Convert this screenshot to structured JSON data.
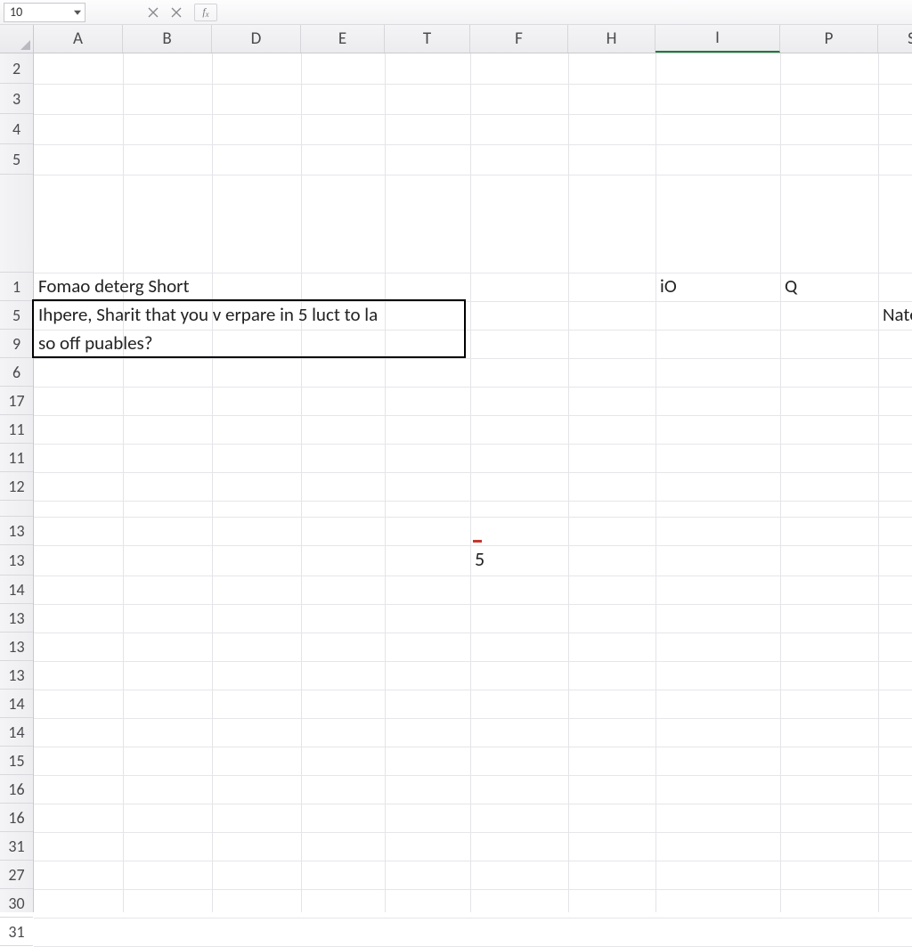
{
  "toolbar": {
    "namebox_value": "10",
    "cancel_icon": "x",
    "enter_icon": "x",
    "fx_label": "fx"
  },
  "columns": [
    {
      "id": "A",
      "label": "A",
      "width": 100
    },
    {
      "id": "B",
      "label": "B",
      "width": 100
    },
    {
      "id": "D",
      "label": "D",
      "width": 100
    },
    {
      "id": "E",
      "label": "E",
      "width": 94
    },
    {
      "id": "T",
      "label": "T",
      "width": 96
    },
    {
      "id": "F",
      "label": "F",
      "width": 110
    },
    {
      "id": "H",
      "label": "H",
      "width": 98
    },
    {
      "id": "I",
      "label": "I",
      "width": 140,
      "active": true
    },
    {
      "id": "P",
      "label": "P",
      "width": 110
    },
    {
      "id": "S",
      "label": "S",
      "width": 76
    }
  ],
  "rows": [
    {
      "id": "2",
      "height": 34
    },
    {
      "id": "3",
      "height": 34
    },
    {
      "id": "4",
      "height": 34
    },
    {
      "id": "5",
      "height": 34
    },
    {
      "id": "gap1",
      "height": 110,
      "blank": true
    },
    {
      "id": "1",
      "height": 32
    },
    {
      "id": "5b",
      "label": "5",
      "height": 32
    },
    {
      "id": "9",
      "height": 32
    },
    {
      "id": "6",
      "height": 32
    },
    {
      "id": "17",
      "height": 32
    },
    {
      "id": "11",
      "height": 32
    },
    {
      "id": "11b",
      "label": "11",
      "height": 32
    },
    {
      "id": "12",
      "height": 32
    },
    {
      "id": "gap2",
      "height": 18,
      "blank": true
    },
    {
      "id": "13",
      "height": 32
    },
    {
      "id": "13b",
      "label": "13",
      "height": 34
    },
    {
      "id": "14",
      "height": 32
    },
    {
      "id": "13c",
      "label": "13",
      "height": 32
    },
    {
      "id": "13d",
      "label": "13",
      "height": 32
    },
    {
      "id": "13e",
      "label": "13",
      "height": 32
    },
    {
      "id": "14b",
      "label": "14",
      "height": 32
    },
    {
      "id": "14c",
      "label": "14",
      "height": 32
    },
    {
      "id": "15",
      "height": 32
    },
    {
      "id": "16",
      "height": 32
    },
    {
      "id": "16b",
      "label": "16",
      "height": 32
    },
    {
      "id": "31",
      "height": 32
    },
    {
      "id": "27",
      "height": 32
    },
    {
      "id": "30",
      "height": 32
    },
    {
      "id": "31b",
      "label": "31",
      "height": 32
    }
  ],
  "cells": {
    "A1": "Fomao deterg Short",
    "I1": "iO",
    "P1": "Q",
    "A5_line1": "Ihpere, Sharit that you v erpare in 5 luct to la",
    "A9_line2": "so off puables?",
    "S5": "Nate V",
    "F13": "5"
  }
}
